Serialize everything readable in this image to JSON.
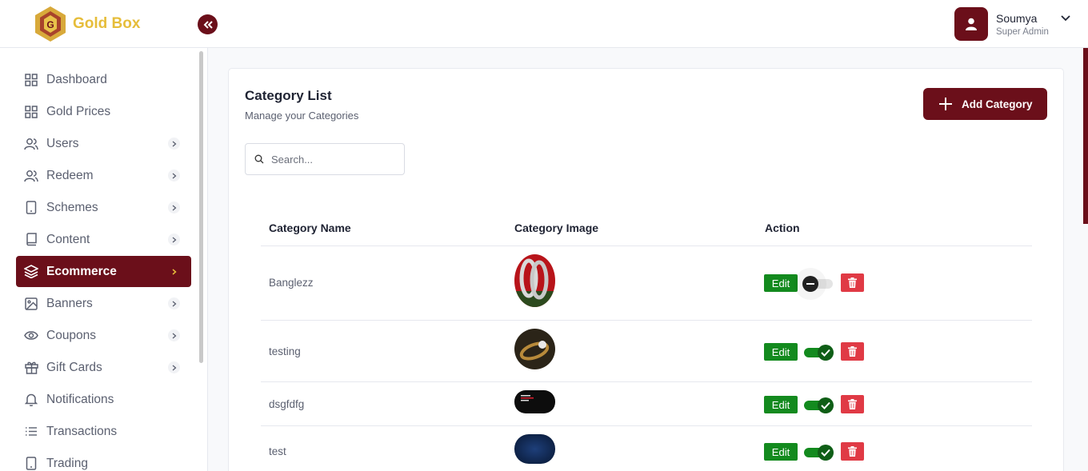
{
  "brand": {
    "name": "Gold Box"
  },
  "user": {
    "name": "Soumya",
    "role": "Super Admin"
  },
  "sidebar": {
    "items": [
      {
        "label": "Dashboard",
        "icon": "grid-icon",
        "has_submenu": false
      },
      {
        "label": "Gold Prices",
        "icon": "grid-icon",
        "has_submenu": false
      },
      {
        "label": "Users",
        "icon": "users-icon",
        "has_submenu": true
      },
      {
        "label": "Redeem",
        "icon": "users-icon",
        "has_submenu": true
      },
      {
        "label": "Schemes",
        "icon": "tablet-icon",
        "has_submenu": true
      },
      {
        "label": "Content",
        "icon": "book-icon",
        "has_submenu": true
      },
      {
        "label": "Ecommerce",
        "icon": "layers-icon",
        "has_submenu": true,
        "active": true
      },
      {
        "label": "Banners",
        "icon": "image-icon",
        "has_submenu": true
      },
      {
        "label": "Coupons",
        "icon": "eye-icon",
        "has_submenu": true
      },
      {
        "label": "Gift Cards",
        "icon": "gift-icon",
        "has_submenu": true
      },
      {
        "label": "Notifications",
        "icon": "bell-icon",
        "has_submenu": false
      },
      {
        "label": "Transactions",
        "icon": "list-icon",
        "has_submenu": false
      },
      {
        "label": "Trading",
        "icon": "tablet-icon",
        "has_submenu": false
      }
    ]
  },
  "page": {
    "title": "Category List",
    "subtitle": "Manage your Categories",
    "add_button": "Add Category",
    "search_placeholder": "Search..."
  },
  "table": {
    "headers": [
      "Category Name",
      "Category Image",
      "Action"
    ],
    "rows": [
      {
        "name": "Banglezz",
        "image": "bangles-photo",
        "active": false
      },
      {
        "name": "testing",
        "image": "ring-photo",
        "active": true
      },
      {
        "name": "dsgfdfg",
        "image": "dark-banner-photo",
        "active": true
      },
      {
        "name": "test",
        "image": "blue-photo",
        "active": true
      }
    ],
    "edit_label": "Edit"
  },
  "colors": {
    "brand": "#6b0f1a",
    "logo_gold": "#e6bd3a",
    "edit_green": "#138a1e",
    "delete_red": "#e03a45"
  }
}
